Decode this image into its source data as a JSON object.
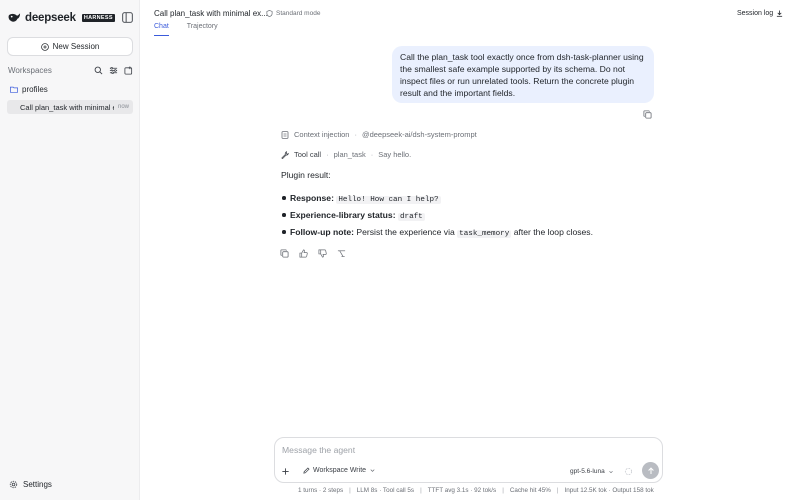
{
  "sidebar": {
    "brand_name": "deepseek",
    "brand_badge": "HARNESS",
    "new_session_label": "New Session",
    "workspaces_label": "Workspaces",
    "folder_name": "profiles",
    "session_title": "Call plan_task with minimal exampl...",
    "session_time": "now",
    "settings_label": "Settings"
  },
  "header": {
    "title": "Call plan_task with minimal ex...",
    "mode": "Standard mode",
    "session_log_label": "Session log",
    "tabs": [
      {
        "label": "Chat",
        "active": true
      },
      {
        "label": "Trajectory",
        "active": false
      }
    ]
  },
  "chat": {
    "user_message": "Call the plan_task tool exactly once from dsh-task-planner using the smallest safe example supported by its schema. Do not inspect files or run unrelated tools. Return the concrete plugin result and the important fields.",
    "context_label": "Context injection",
    "context_value": "@deepseek-ai/dsh-system-prompt",
    "tool_label": "Tool call",
    "tool_name": "plan_task",
    "tool_args": "Say hello.",
    "result_label": "Plugin result:",
    "bullets": [
      {
        "label": "Response:",
        "code": "Hello! How can I help?",
        "pre": "",
        "post": ""
      },
      {
        "label": "Experience-library status:",
        "code": "draft",
        "pre": "",
        "post": ""
      },
      {
        "label": "Follow-up note:",
        "pre": "Persist the experience via",
        "code": "task_memory",
        "post": "after the loop closes."
      }
    ]
  },
  "composer": {
    "placeholder": "Message the agent",
    "permission": "Workspace Write",
    "model": "gpt-5.6-luna"
  },
  "stats": [
    "1 turns · 2 steps",
    "LLM 8s · Tool call 5s",
    "TTFT avg 3.1s · 92 tok/s",
    "Cache hit 45%",
    "Input 12.5K tok · Output 158 tok"
  ]
}
